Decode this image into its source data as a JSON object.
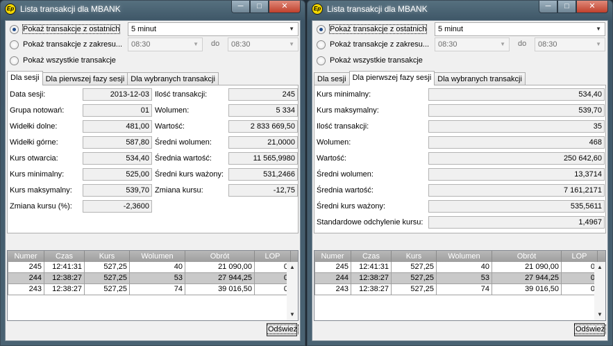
{
  "left": {
    "title": "Lista transakcji dla MBANK",
    "app_icon": "Ep",
    "radio1": "Pokaż transakcje z ostatnich",
    "radio2": "Pokaż transakcje z zakresu...",
    "radio3": "Pokaż wszystkie transakcje",
    "combo_last": "5 minut",
    "range_from": "08:30",
    "range_to_label": "do",
    "range_to": "08:30",
    "tabs": [
      "Dla sesji",
      "Dla pierwszej fazy sesji",
      "Dla wybranych transakcji"
    ],
    "fields_left": [
      {
        "label": "Data sesji:",
        "value": "2013-12-03"
      },
      {
        "label": "Grupa notowań:",
        "value": "01"
      },
      {
        "label": "Widełki dolne:",
        "value": "481,00"
      },
      {
        "label": "Widełki górne:",
        "value": "587,80"
      },
      {
        "label": "Kurs otwarcia:",
        "value": "534,40"
      },
      {
        "label": "Kurs minimalny:",
        "value": "525,00"
      },
      {
        "label": "Kurs maksymalny:",
        "value": "539,70"
      },
      {
        "label": "Zmiana kursu (%):",
        "value": "-2,3600"
      }
    ],
    "fields_right": [
      {
        "label": "Ilość transakcji:",
        "value": "245"
      },
      {
        "label": "Wolumen:",
        "value": "5 334"
      },
      {
        "label": "Wartość:",
        "value": "2 833 669,50"
      },
      {
        "label": "Średni wolumen:",
        "value": "21,0000"
      },
      {
        "label": "Średnia wartość:",
        "value": "11 565,9980"
      },
      {
        "label": "Średni kurs ważony:",
        "value": "531,2466"
      },
      {
        "label": "Zmiana kursu:",
        "value": "-12,75"
      }
    ],
    "columns": [
      "Numer",
      "Czas",
      "Kurs",
      "Wolumen",
      "Obrót",
      "LOP"
    ],
    "rows": [
      [
        "245",
        "12:41:31",
        "527,25",
        "40",
        "21 090,00",
        "0"
      ],
      [
        "244",
        "12:38:27",
        "527,25",
        "53",
        "27 944,25",
        "0"
      ],
      [
        "243",
        "12:38:27",
        "527,25",
        "74",
        "39 016,50",
        "0"
      ]
    ],
    "refresh": "Odśwież"
  },
  "right": {
    "title": "Lista transakcji dla MBANK",
    "app_icon": "Ep",
    "radio1": "Pokaż transakcje z ostatnich",
    "radio2": "Pokaż transakcje z zakresu...",
    "radio3": "Pokaż wszystkie transakcje",
    "combo_last": "5 minut",
    "range_from": "08:30",
    "range_to_label": "do",
    "range_to": "08:30",
    "tabs": [
      "Dla sesji",
      "Dla pierwszej fazy sesji",
      "Dla wybranych transakcji"
    ],
    "fields": [
      {
        "label": "Kurs minimalny:",
        "value": "534,40"
      },
      {
        "label": "Kurs maksymalny:",
        "value": "539,70"
      },
      {
        "label": "Ilość transakcji:",
        "value": "35"
      },
      {
        "label": "Wolumen:",
        "value": "468"
      },
      {
        "label": "Wartość:",
        "value": "250 642,60"
      },
      {
        "label": "Średni wolumen:",
        "value": "13,3714"
      },
      {
        "label": "Średnia wartość:",
        "value": "7 161,2171"
      },
      {
        "label": "Średni kurs ważony:",
        "value": "535,5611"
      },
      {
        "label": "Standardowe odchylenie kursu:",
        "value": "1,4967"
      }
    ],
    "columns": [
      "Numer",
      "Czas",
      "Kurs",
      "Wolumen",
      "Obrót",
      "LOP"
    ],
    "rows": [
      [
        "245",
        "12:41:31",
        "527,25",
        "40",
        "21 090,00",
        "0"
      ],
      [
        "244",
        "12:38:27",
        "527,25",
        "53",
        "27 944,25",
        "0"
      ],
      [
        "243",
        "12:38:27",
        "527,25",
        "74",
        "39 016,50",
        "0"
      ]
    ],
    "refresh": "Odśwież"
  },
  "icons": {
    "minimize": "minimize-icon",
    "maximize": "maximize-icon",
    "close": "close-icon",
    "combo_arrow": "chevron-down-icon",
    "scroll_up": "arrow-up-icon",
    "scroll_down": "arrow-down-icon"
  },
  "colors": {
    "window_frame": "#4a6373",
    "client_bg": "#f0f0f0",
    "selected_row": "#c9c9c9",
    "grid_header": "#a8a8a8",
    "close_button": "#c0402c"
  }
}
